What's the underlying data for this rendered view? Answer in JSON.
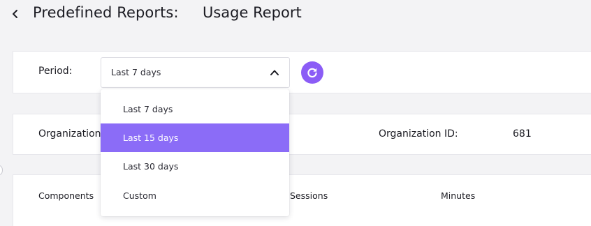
{
  "header": {
    "title": "Predefined Reports:",
    "subtitle": "Usage Report",
    "back_icon": "chevron-left-icon"
  },
  "period": {
    "label": "Period:",
    "selected_value": "Last 7 days",
    "chevron_icon": "chevron-up-icon",
    "refresh_icon": "refresh-icon",
    "options": [
      "Last 7 days",
      "Last 15 days",
      "Last 30 days",
      "Custom"
    ],
    "highlighted_option": "Last 15 days"
  },
  "organization": {
    "name_label": "Organization",
    "id_label": "Organization ID:",
    "id_value": "681"
  },
  "table": {
    "columns": [
      "Components",
      "Sessions",
      "Minutes"
    ]
  },
  "colors": {
    "accent": "#8b5cf6",
    "highlight": "#8b6cf7",
    "background": "#f3f3f5",
    "card": "#ffffff"
  }
}
